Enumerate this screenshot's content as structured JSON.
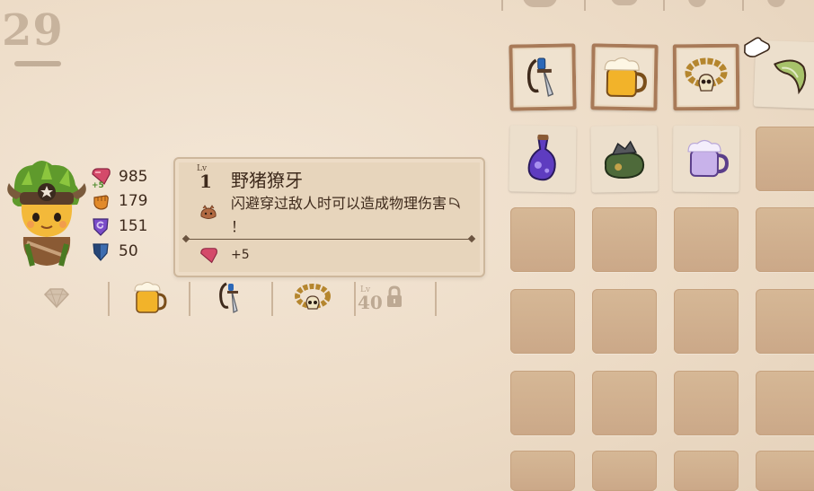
{
  "header": {
    "level_number": "29"
  },
  "hero": {
    "stats": [
      {
        "icon": "heart-icon",
        "value": "985",
        "bonus": "+5"
      },
      {
        "icon": "fist-icon",
        "value": "179"
      },
      {
        "icon": "swirl-shield-icon",
        "value": "151"
      },
      {
        "icon": "shield-icon",
        "value": "50"
      }
    ]
  },
  "tooltip": {
    "level_label": "Lv",
    "level": "1",
    "title": "野猪獠牙",
    "description": "闪避穿过敌人时可以造成物理伤害",
    "description_end": "！",
    "bonus": "+5"
  },
  "equipment_row": {
    "slots": [
      "gem-icon",
      "beer-mug-icon",
      "hook-dagger-icon",
      "skull-necklace-icon"
    ],
    "locked_label": "Lv",
    "locked_level": "40"
  },
  "inventory": {
    "items": [
      {
        "icon": "hook-dagger-icon"
      },
      {
        "icon": "beer-mug-icon"
      },
      {
        "icon": "skull-necklace-icon"
      },
      {
        "icon": "boar-tusk-icon"
      },
      {
        "icon": "purple-potion-icon"
      },
      {
        "icon": "rock-sack-icon"
      },
      {
        "icon": "purple-mug-icon"
      }
    ]
  },
  "colors": {
    "background": "#eddcc7",
    "slot": "#d0ad8c",
    "heart": "#d44a6a",
    "fist": "#e28a2a",
    "magic": "#7a4cc8",
    "armor": "#3d6db0"
  }
}
